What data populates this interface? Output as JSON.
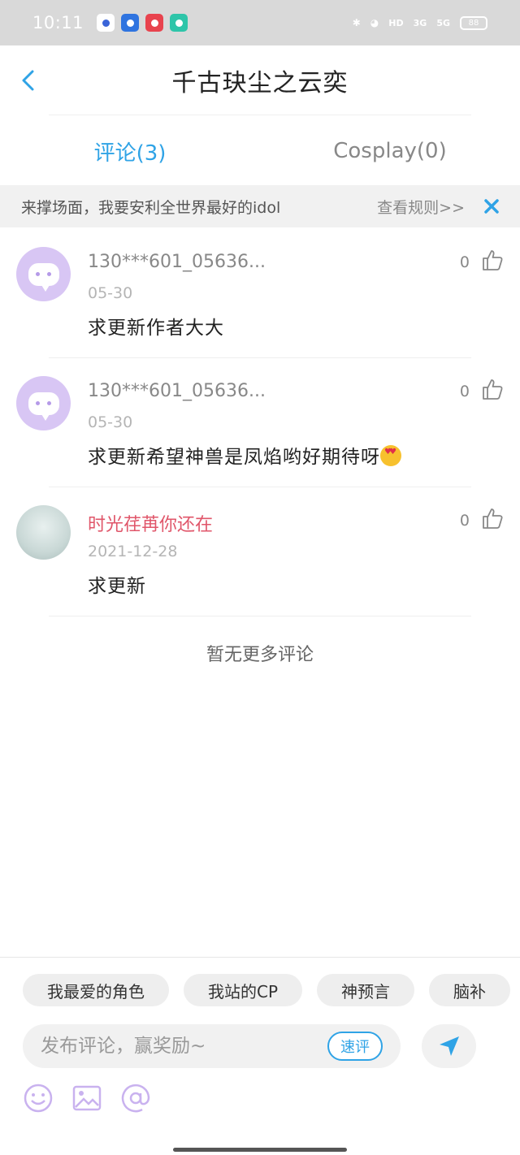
{
  "status": {
    "time": "10:11",
    "battery": "88",
    "net1": "3G",
    "net2": "5G",
    "hd": "HD"
  },
  "header": {
    "title": "千古玦尘之云奕"
  },
  "tabs": [
    {
      "label": "评论(3)",
      "active": true
    },
    {
      "label": "Cosplay(0)",
      "active": false
    }
  ],
  "notice": {
    "text": "来撑场面，我要安利全世界最好的idol",
    "rules": "查看规则>>"
  },
  "comments": [
    {
      "user": "130***601_05636...",
      "date": "05-30",
      "text": "求更新作者大大",
      "likes": "0"
    },
    {
      "user": "130***601_05636...",
      "date": "05-30",
      "text": "求更新希望神兽是凤焰哟好期待呀",
      "likes": "0"
    },
    {
      "user": "时光荏苒你还在",
      "date": "2021-12-28",
      "text": "求更新",
      "likes": "0"
    }
  ],
  "no_more": "暂无更多评论",
  "chips": [
    "我最爱的角色",
    "我站的CP",
    "神预言",
    "脑补"
  ],
  "input": {
    "placeholder": "发布评论，赢奖励~",
    "value": "",
    "quick": "速评"
  },
  "colors": {
    "accent": "#2fa3e6",
    "purple": "#b59ae8",
    "pink_user": "#e0566a"
  }
}
